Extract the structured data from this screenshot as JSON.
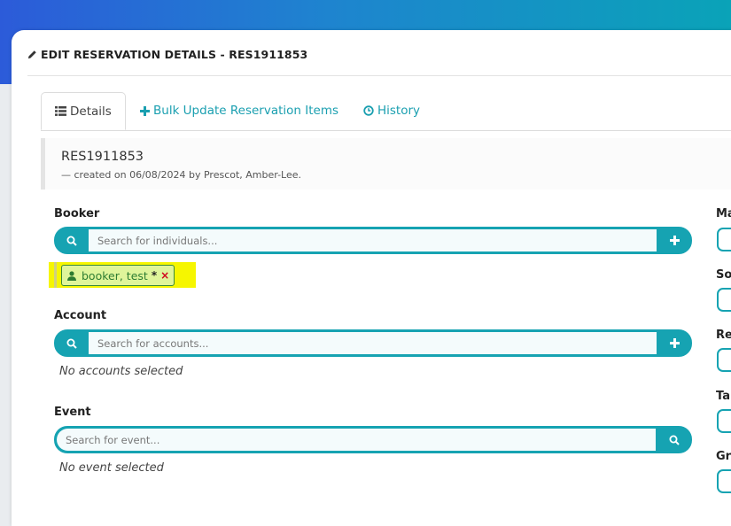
{
  "header": {
    "title": "EDIT RESERVATION DETAILS - RES1911853"
  },
  "tabs": [
    {
      "label": "Details",
      "icon": "list-icon",
      "active": true
    },
    {
      "label": "Bulk Update Reservation Items",
      "icon": "plus-icon",
      "active": false
    },
    {
      "label": "History",
      "icon": "clock-icon",
      "active": false
    }
  ],
  "summary": {
    "reference": "RES1911853",
    "created": "— created on 06/08/2024 by Prescot, Amber-Lee."
  },
  "booker": {
    "label": "Booker",
    "placeholder": "Search for individuals...",
    "selected": {
      "name": "booker, test",
      "star": "*",
      "remove": "×"
    }
  },
  "account": {
    "label": "Account",
    "placeholder": "Search for accounts...",
    "empty": "No accounts selected"
  },
  "event": {
    "label": "Event",
    "placeholder": "Search for event...",
    "empty": "No event selected"
  },
  "side_labels": [
    "Ma",
    "So",
    "Re",
    "Ta",
    "Gr"
  ],
  "colors": {
    "accent": "#16a3b2",
    "highlight": "#f6f600",
    "chip_bg": "#dff59a",
    "chip_text": "#2e7d32",
    "remove": "#d0021b"
  }
}
